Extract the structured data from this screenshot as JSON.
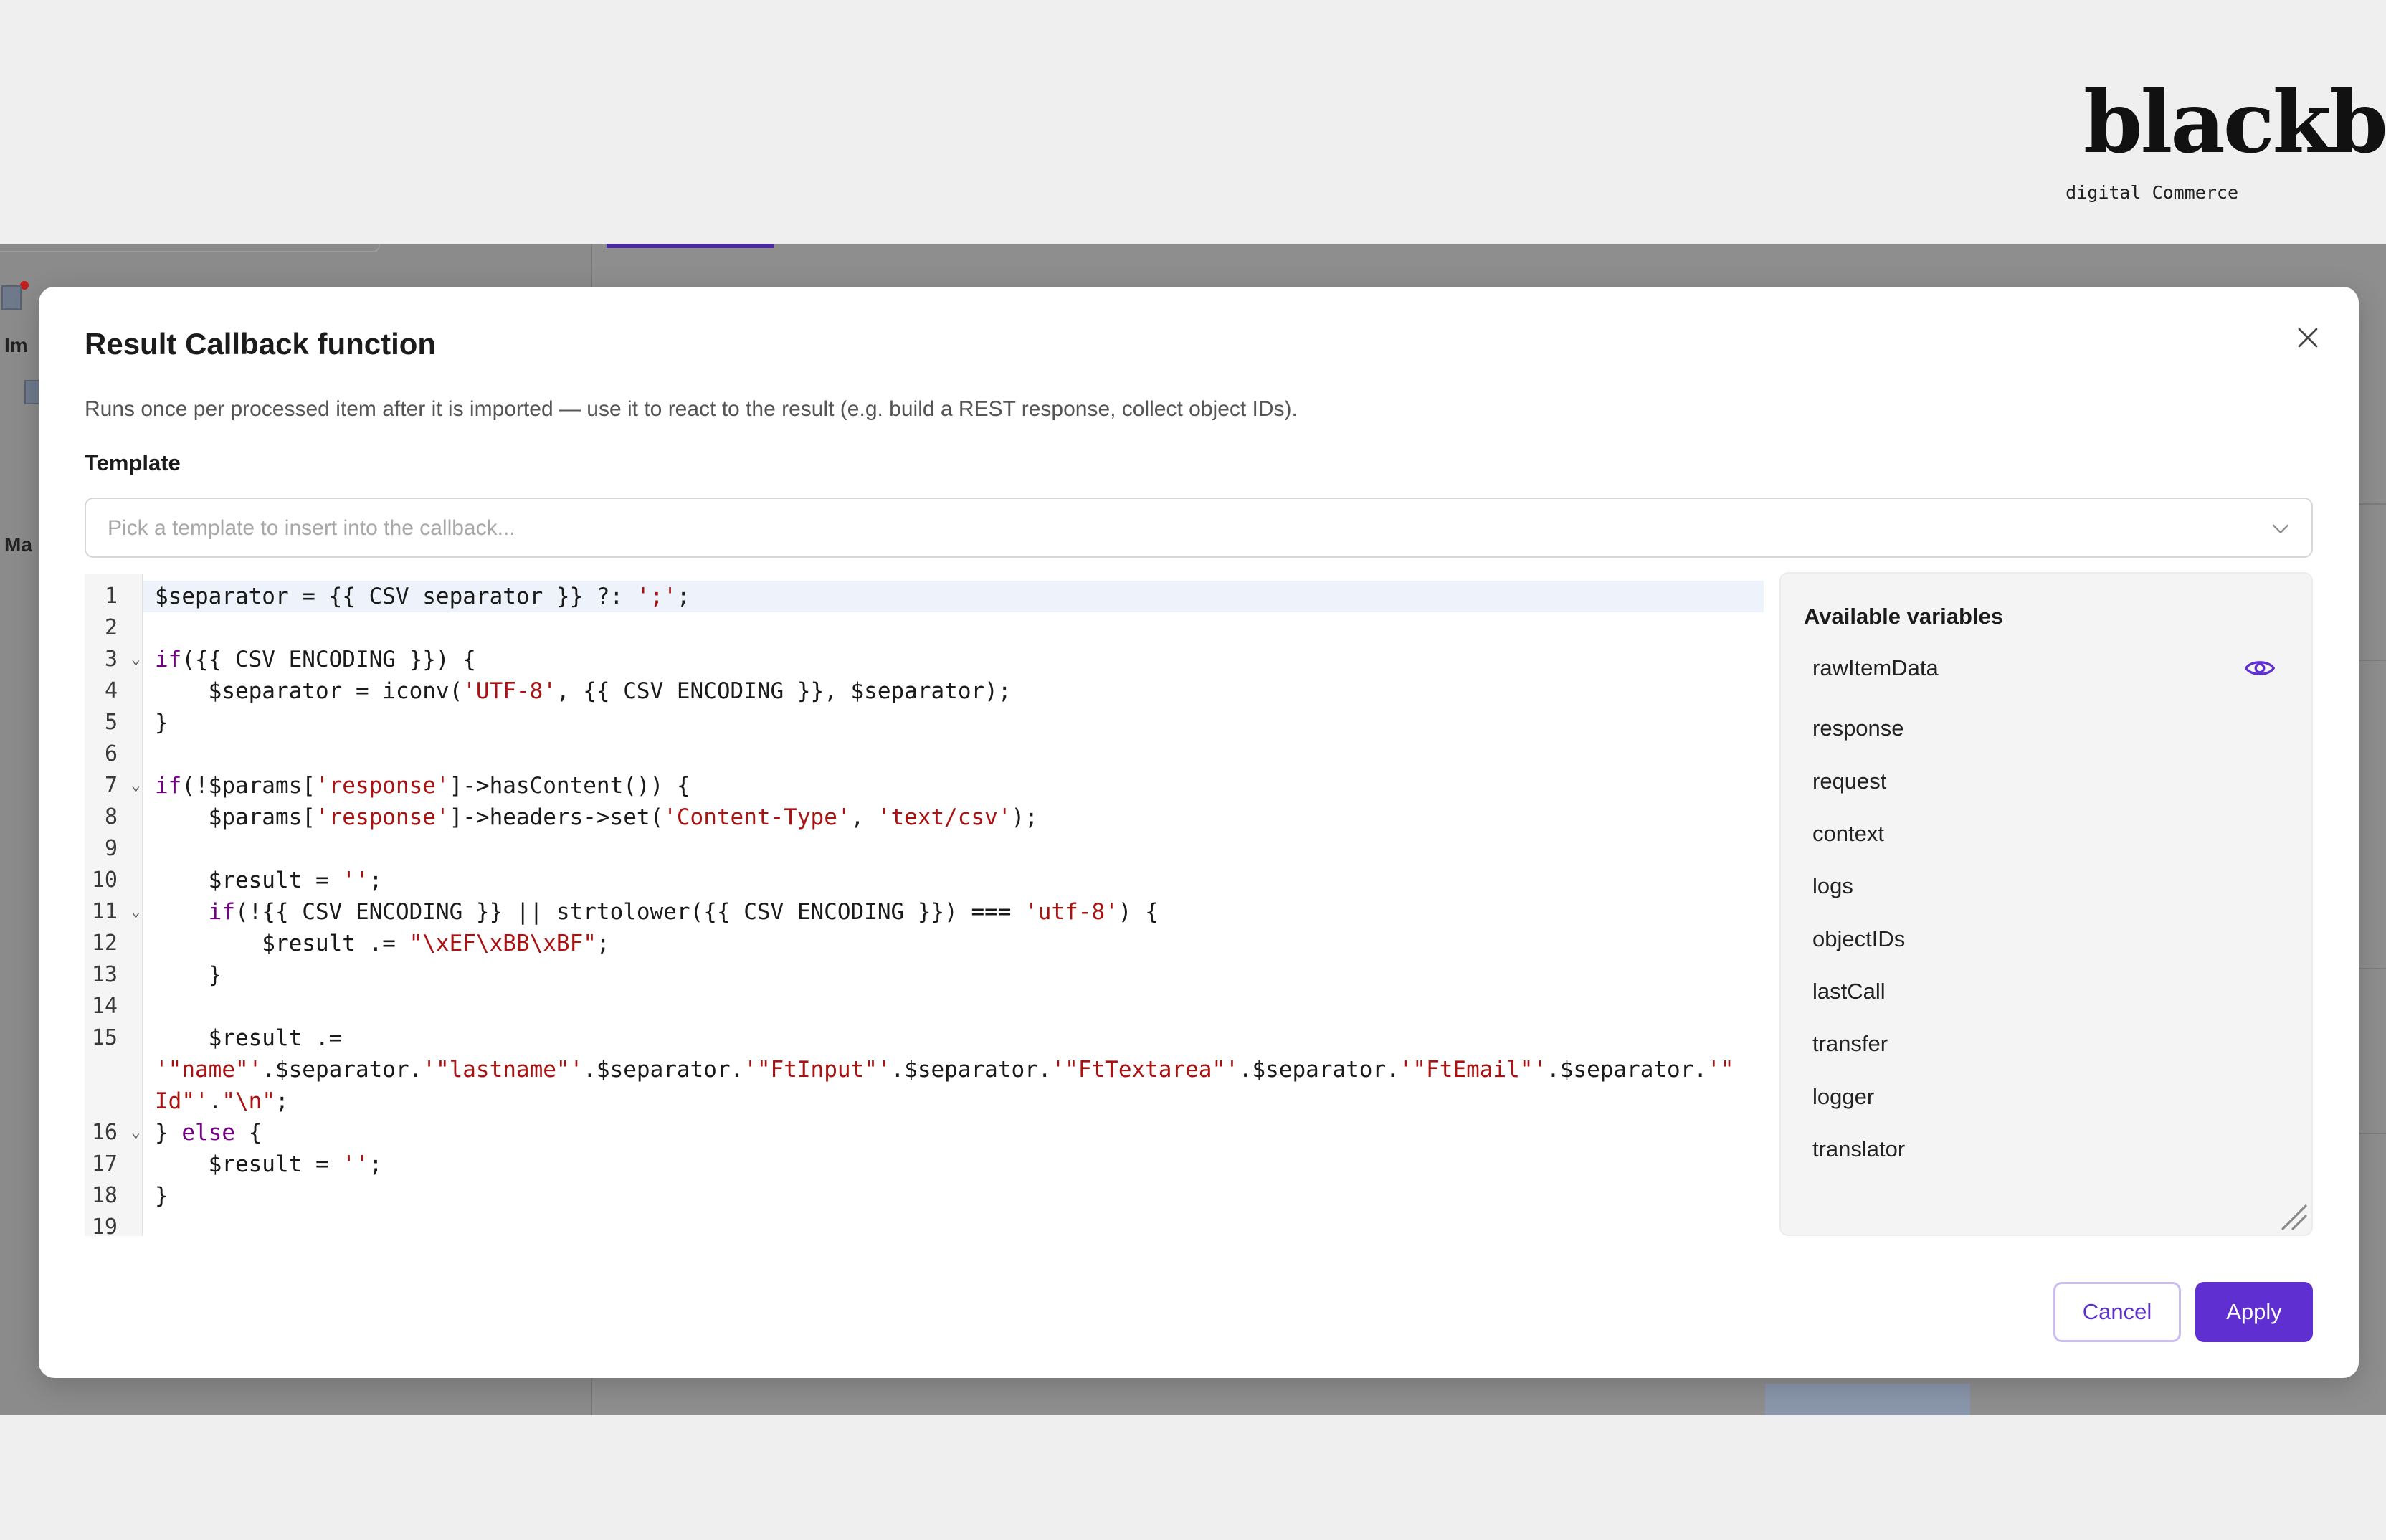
{
  "brand": {
    "name": "blackbit",
    "tagline": "digital Commerce"
  },
  "background": {
    "label_1": "Im",
    "label_2": "Ma"
  },
  "modal": {
    "title": "Result Callback function",
    "description": "Runs once per processed item after it is imported — use it to react to the result (e.g. build a REST response, collect object IDs).",
    "template_label": "Template",
    "template_placeholder": "Pick a template to insert into the callback...",
    "cancel_label": "Cancel",
    "apply_label": "Apply"
  },
  "editor": {
    "line_numbers": [
      "1",
      "2",
      "3",
      "4",
      "5",
      "6",
      "7",
      "8",
      "9",
      "10",
      "11",
      "12",
      "13",
      "14",
      "15",
      "",
      "",
      "16",
      "17",
      "18",
      "19"
    ],
    "foldable_lines": [
      "3",
      "7",
      "11",
      "16"
    ],
    "lines": [
      [
        {
          "t": "$separator = {{ CSV separator }} ?: "
        },
        {
          "s": "';'"
        },
        {
          "t": ";"
        }
      ],
      [],
      [
        {
          "k": "if"
        },
        {
          "t": "({{ CSV ENCODING }}) {"
        }
      ],
      [
        {
          "t": "    $separator = iconv("
        },
        {
          "s": "'UTF-8'"
        },
        {
          "t": ", {{ CSV ENCODING }}, $separator);"
        }
      ],
      [
        {
          "t": "}"
        }
      ],
      [],
      [
        {
          "k": "if"
        },
        {
          "t": "(!$params["
        },
        {
          "s": "'response'"
        },
        {
          "t": "]->hasContent()) {"
        }
      ],
      [
        {
          "t": "    $params["
        },
        {
          "s": "'response'"
        },
        {
          "t": "]->headers->set("
        },
        {
          "s": "'Content-Type'"
        },
        {
          "t": ", "
        },
        {
          "s": "'text/csv'"
        },
        {
          "t": ");"
        }
      ],
      [],
      [
        {
          "t": "    $result = "
        },
        {
          "s": "''"
        },
        {
          "t": ";"
        }
      ],
      [
        {
          "t": "    "
        },
        {
          "k": "if"
        },
        {
          "t": "(!{{ CSV ENCODING }} || strtolower({{ CSV ENCODING }}) === "
        },
        {
          "s": "'utf-8'"
        },
        {
          "t": ") {"
        }
      ],
      [
        {
          "t": "        $result .= "
        },
        {
          "s": "\"\\xEF\\xBB\\xBF\""
        },
        {
          "t": ";"
        }
      ],
      [
        {
          "t": "    }"
        }
      ],
      [],
      [
        {
          "t": "    $result .="
        }
      ],
      [
        {
          "s": "'\"name\"'"
        },
        {
          "t": ".$separator."
        },
        {
          "s": "'\"lastname\"'"
        },
        {
          "t": ".$separator."
        },
        {
          "s": "'\"FtInput\"'"
        },
        {
          "t": ".$separator."
        },
        {
          "s": "'\"FtTextarea\"'"
        },
        {
          "t": ".$separator."
        },
        {
          "s": "'\"FtEmail\"'"
        },
        {
          "t": ".$separator."
        },
        {
          "s": "'\""
        }
      ],
      [
        {
          "s": "Id\"'"
        },
        {
          "t": "."
        },
        {
          "s": "\"\\n\""
        },
        {
          "t": ";"
        }
      ],
      [
        {
          "t": "} "
        },
        {
          "k": "else"
        },
        {
          "t": " {"
        }
      ],
      [
        {
          "t": "    $result = "
        },
        {
          "s": "''"
        },
        {
          "t": ";"
        }
      ],
      [
        {
          "t": "}"
        }
      ],
      []
    ]
  },
  "variables": {
    "title": "Available variables",
    "items": [
      "rawItemData",
      "response",
      "request",
      "context",
      "logs",
      "objectIDs",
      "lastCall",
      "transfer",
      "logger",
      "translator"
    ]
  },
  "colors": {
    "accent": "#5f2fd1",
    "keyword": "#770088",
    "string": "#aa1111"
  }
}
